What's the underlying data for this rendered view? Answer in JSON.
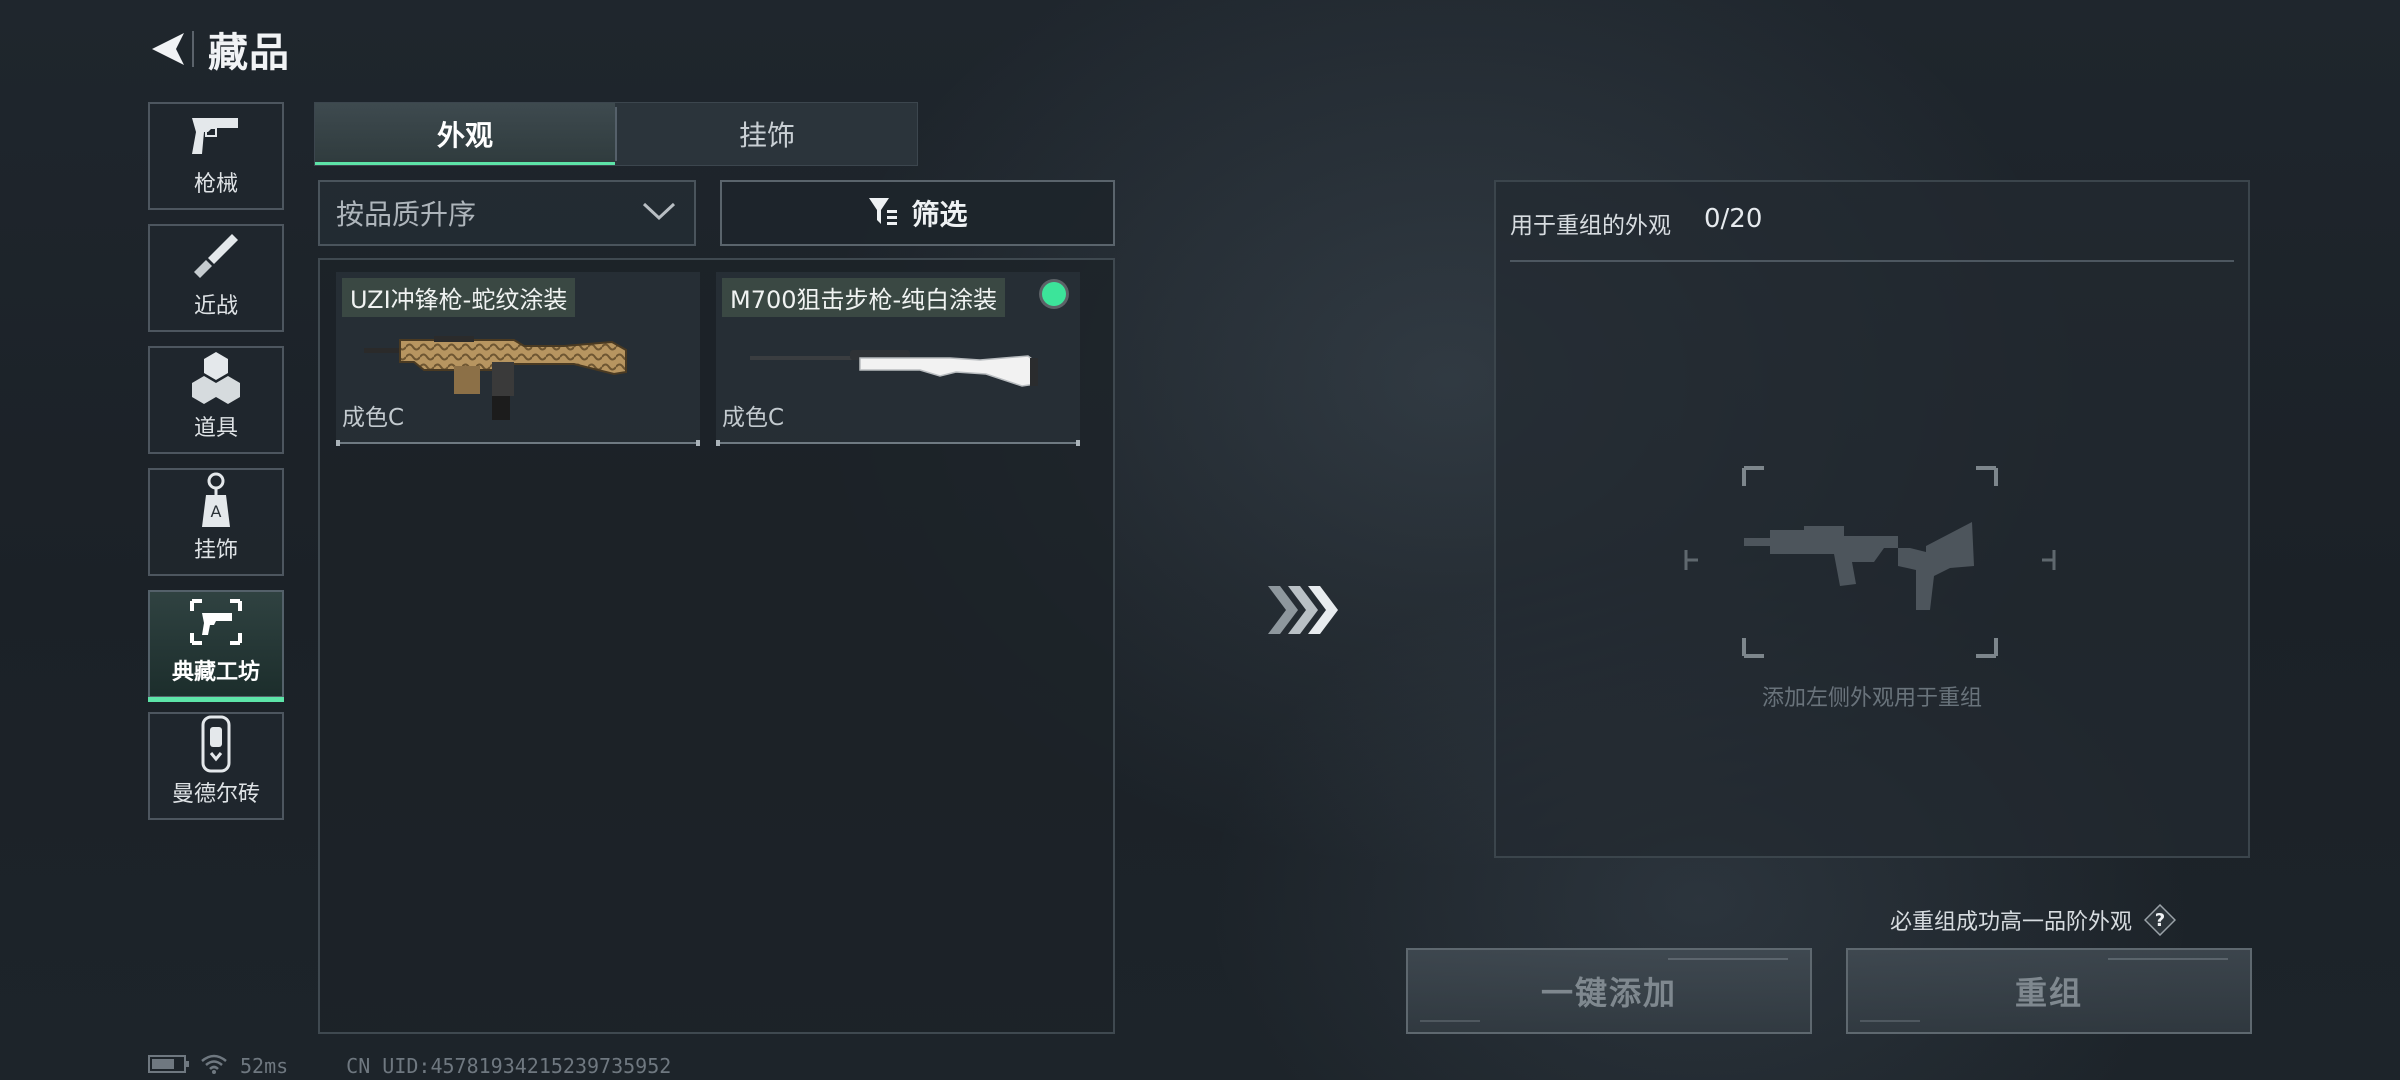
{
  "header": {
    "title": "藏品"
  },
  "categories": [
    {
      "label": "枪械",
      "icon": "pistol-icon"
    },
    {
      "label": "近战",
      "icon": "knife-icon"
    },
    {
      "label": "道具",
      "icon": "grenades-icon"
    },
    {
      "label": "挂饰",
      "icon": "charm-icon"
    },
    {
      "label": "典藏工坊",
      "icon": "workshop-gun-frame-icon",
      "active": true
    },
    {
      "label": "曼德尔砖",
      "icon": "mandel-brick-icon"
    }
  ],
  "tabs": [
    {
      "label": "外观",
      "active": true
    },
    {
      "label": "挂饰",
      "active": false
    }
  ],
  "sort": {
    "label": "按品质升序"
  },
  "filter": {
    "label": "筛选",
    "icon": "filter-funnel-icon"
  },
  "items": [
    {
      "name": "UZI冲锋枪-蛇纹涂装",
      "grade": "成色C",
      "icon": "uzi-smg-snake-skin-icon",
      "new": false
    },
    {
      "name": "M700狙击步枪-纯白涂装",
      "grade": "成色C",
      "icon": "m700-sniper-white-icon",
      "new": true
    }
  ],
  "recombine": {
    "title": "用于重组的外观",
    "count": "0/20",
    "hint": "添加左侧外观用于重组",
    "placeholder_icon": "assault-rifle-silhouette-icon"
  },
  "guarantee": {
    "text": "必重组成功高一品阶外观",
    "help": "?"
  },
  "buttons": {
    "add_all": "一键添加",
    "recombine": "重组"
  },
  "status": {
    "ping": "52ms",
    "uid": "CN UID:4578193421523973595​2"
  },
  "colors": {
    "accent": "#5de4a8",
    "new_dot": "#3ce49a"
  }
}
